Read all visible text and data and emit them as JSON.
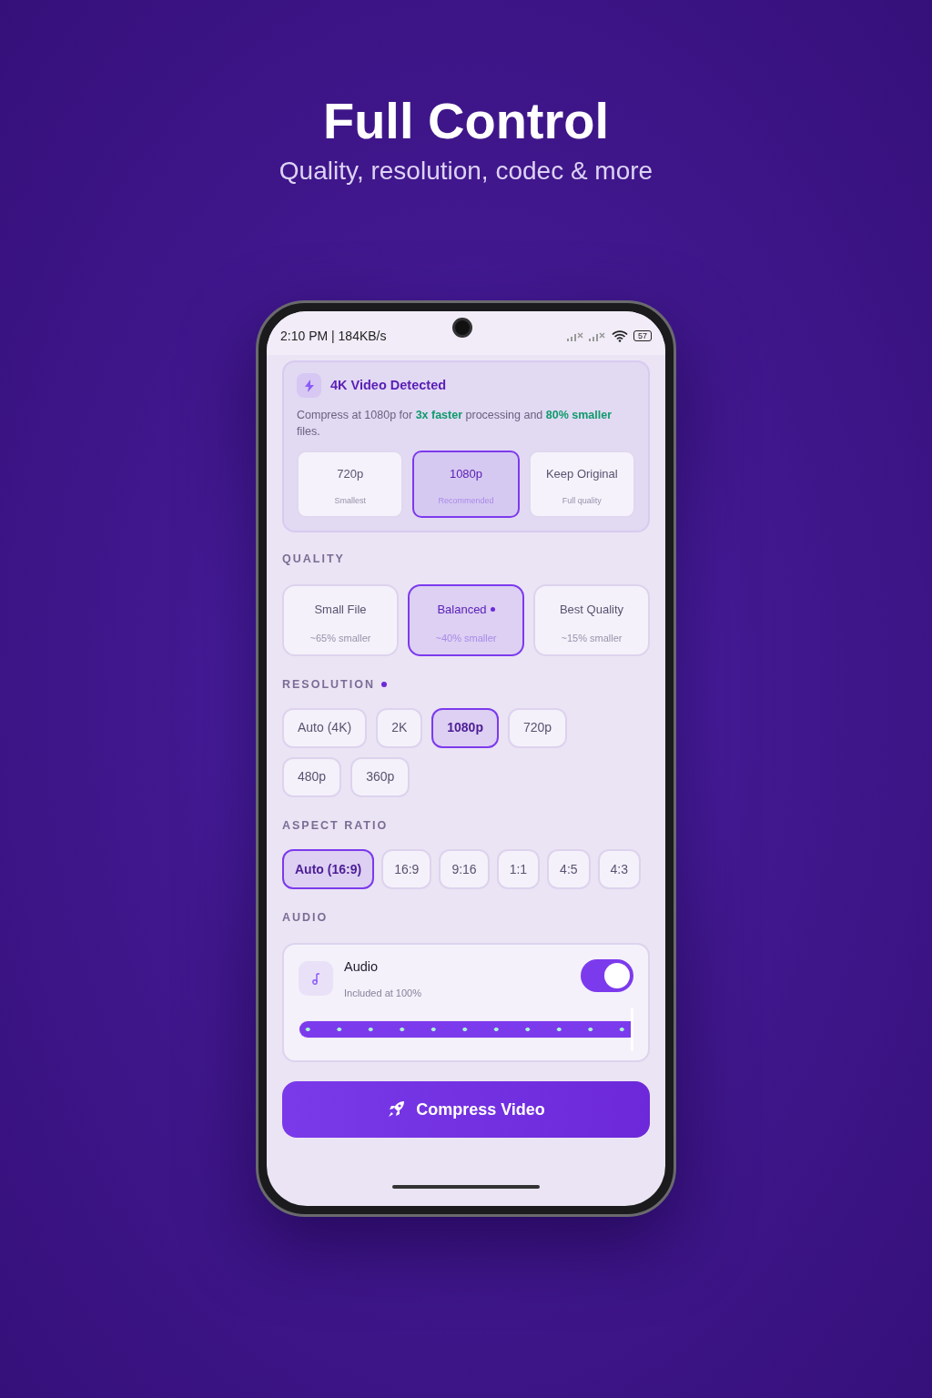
{
  "headline": {
    "title": "Full Control",
    "subtitle": "Quality, resolution, codec & more"
  },
  "status_bar": {
    "time": "2:10 PM | 184KB/s",
    "battery": "57"
  },
  "detection_card": {
    "title": "4K Video Detected",
    "message": "Compress at 1080p for **3x faster** processing and **80% smaller** files.",
    "options": [
      {
        "label": "720p",
        "note": "Smallest",
        "selected": false
      },
      {
        "label": "1080p",
        "note": "Recommended",
        "selected": true
      },
      {
        "label": "Keep Original",
        "note": "Full quality",
        "selected": false
      }
    ]
  },
  "quality": {
    "heading": "QUALITY",
    "modified": false,
    "options": [
      {
        "label": "Small File",
        "note": "~65% smaller",
        "selected": false,
        "marked": false
      },
      {
        "label": "Balanced",
        "note": "~40% smaller",
        "selected": true,
        "marked": true
      },
      {
        "label": "Best Quality",
        "note": "~15% smaller",
        "selected": false,
        "marked": false
      }
    ]
  },
  "resolution": {
    "heading": "RESOLUTION",
    "modified": true,
    "options": [
      {
        "label": "Auto (4K)",
        "selected": false
      },
      {
        "label": "2K",
        "selected": false
      },
      {
        "label": "1080p",
        "selected": true
      },
      {
        "label": "720p",
        "selected": false
      },
      {
        "label": "480p",
        "selected": false
      },
      {
        "label": "360p",
        "selected": false
      }
    ]
  },
  "aspect_ratio": {
    "heading": "ASPECT RATIO",
    "modified": false,
    "options": [
      {
        "label": "Auto (16:9)",
        "selected": true
      },
      {
        "label": "16:9",
        "selected": false
      },
      {
        "label": "9:16",
        "selected": false
      },
      {
        "label": "1:1",
        "selected": false
      },
      {
        "label": "4:5",
        "selected": false
      },
      {
        "label": "4:3",
        "selected": false
      }
    ]
  },
  "audio": {
    "heading": "AUDIO",
    "modified": false,
    "title": "Audio",
    "subtitle": "Included at 100%",
    "on": true,
    "level": 1
  },
  "action_button": {
    "label": "Compress Video"
  }
}
